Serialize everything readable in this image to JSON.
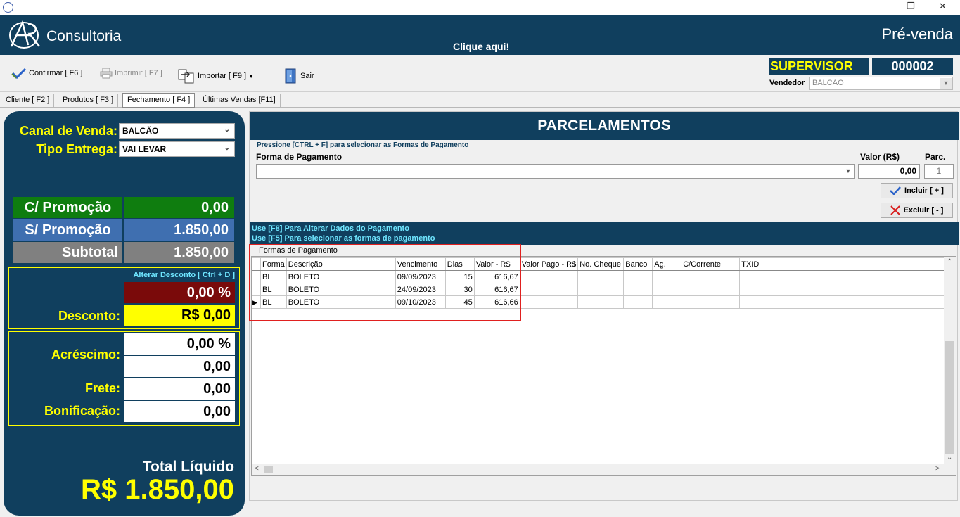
{
  "app": {
    "brand": "Consultoria",
    "banner_link": "Clique aqui!",
    "screen_title": "Pré-venda",
    "window_buttons": [
      "❐",
      "✕"
    ]
  },
  "toolbar": {
    "confirm": "Confirmar [ F6 ]",
    "print": "Imprimir  [ F7 ]",
    "import": "Importar [ F9 ]",
    "exit": "Sair"
  },
  "user": {
    "role": "SUPERVISOR",
    "code": "000002",
    "vendor_label": "Vendedor",
    "vendor_value": "BALCAO"
  },
  "tabs": [
    "Cliente [ F2 ]",
    "Produtos [ F3 ]",
    "Fechamento [ F4 ]",
    "Últimas Vendas [F11]"
  ],
  "left": {
    "canal_label": "Canal de Venda:",
    "canal_value": "BALCÃO",
    "tipo_label": "Tipo Entrega:",
    "tipo_value": "VAI LEVAR",
    "promo_label": "C/ Promoção",
    "promo_value": "0,00",
    "sem_promo_label": "S/ Promoção",
    "sem_promo_value": "1.850,00",
    "subtotal_label": "Subtotal",
    "subtotal_value": "1.850,00",
    "alterar_desconto": "Alterar Desconto  [ Ctrl + D ]",
    "desconto_pct": "0,00 %",
    "desconto_label": "Desconto:",
    "desconto_value": "R$ 0,00",
    "acrescimo_label": "Acréscimo:",
    "acrescimo_pct": "0,00 %",
    "acrescimo_value": "0,00",
    "frete_label": "Frete:",
    "frete_value": "0,00",
    "bonificacao_label": "Bonificação:",
    "bonificacao_value": "0,00",
    "total_label": "Total Líquido",
    "total_value": "R$ 1.850,00"
  },
  "right": {
    "title": "PARCELAMENTOS",
    "hint": "Pressione [CTRL + F] para selecionar as Formas de Pagamento",
    "forma_label": "Forma de Pagamento",
    "valor_label": "Valor (R$)",
    "parc_label": "Parc.",
    "valor_value": "0,00",
    "parc_value": "1",
    "incluir": "Incluir [ + ]",
    "excluir": "Excluir [ - ]",
    "hint_f8": "Use [F8] Para Alterar Dados do Pagamento",
    "hint_f5": "Use [F5] Para selecionar as formas de pagamento",
    "grid_caption": "Formas de Pagamento",
    "columns": [
      "Forma",
      "Descrição",
      "Vencimento",
      "Dias",
      "Valor - R$",
      "Valor Pago - R$",
      "No. Cheque",
      "Banco",
      "Ag.",
      "C/Corrente",
      "TXID"
    ],
    "rows": [
      {
        "forma": "BL",
        "descricao": "BOLETO",
        "vencimento": "09/09/2023",
        "dias": "15",
        "valor": "616,67"
      },
      {
        "forma": "BL",
        "descricao": "BOLETO",
        "vencimento": "24/09/2023",
        "dias": "30",
        "valor": "616,67"
      },
      {
        "forma": "BL",
        "descricao": "BOLETO",
        "vencimento": "09/10/2023",
        "dias": "45",
        "valor": "616,66"
      }
    ]
  },
  "colors": {
    "navy": "#103f5e",
    "yellow": "#ffff00",
    "green": "#0f7d0f",
    "blue": "#3f6fb0",
    "gray": "#808080",
    "maroon": "#7a0a0a",
    "highlight": "#e0201f"
  }
}
